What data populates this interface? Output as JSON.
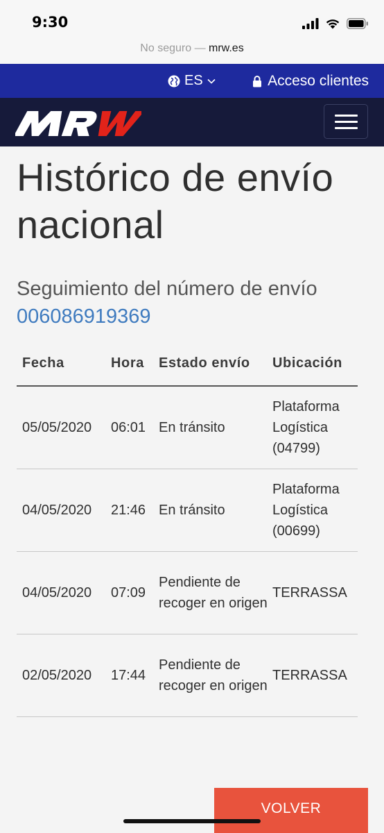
{
  "status_bar": {
    "time": "9:30"
  },
  "browser": {
    "security": "No seguro —",
    "domain": "mrw.es"
  },
  "top_strip": {
    "language": "ES",
    "access_label": "Acceso clientes"
  },
  "nav": {
    "logo_text": "MRW"
  },
  "page": {
    "title": "Histórico de envío nacional",
    "subtitle": "Seguimiento del número de envío",
    "tracking_number": "006086919369"
  },
  "table": {
    "headers": [
      "Fecha",
      "Hora",
      "Estado envío",
      "Ubicación"
    ],
    "rows": [
      [
        "05/05/2020",
        "06:01",
        "En tránsito",
        "Plataforma Logística (04799)"
      ],
      [
        "04/05/2020",
        "21:46",
        "En tránsito",
        "Plataforma Logística (00699)"
      ],
      [
        "04/05/2020",
        "07:09",
        "Pendiente de recoger en origen",
        "TERRASSA"
      ],
      [
        "02/05/2020",
        "17:44",
        "Pendiente de recoger en origen",
        "TERRASSA"
      ]
    ]
  },
  "actions": {
    "back_label": "VOLVER"
  },
  "colors": {
    "top_strip": "#1e2a9e",
    "nav": "#161a3a",
    "link": "#3f7bbf",
    "button": "#e8533d"
  },
  "icons": [
    "globe-icon",
    "chevron-down-icon",
    "lock-icon",
    "hamburger-menu-icon",
    "signal-icon",
    "wifi-icon",
    "battery-icon"
  ]
}
